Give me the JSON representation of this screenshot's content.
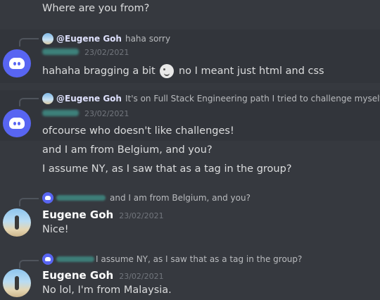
{
  "messages": [
    {
      "text": "Where are you from?"
    },
    {
      "reply": {
        "mention": "@Eugene Goh",
        "text": "haha sorry"
      },
      "timestamp": "23/02/2021",
      "lines": [
        "hahaha bragging a bit",
        "no I meant just html and css"
      ]
    },
    {
      "reply": {
        "mention": "@Eugene Goh",
        "text": "It's on Full Stack Engineering path I tried to challenge myself."
      },
      "timestamp": "23/02/2021",
      "lines": [
        "ofcourse who doesn't like challenges!",
        "and I am from Belgium, and you?",
        "I assume NY, as I saw that as a tag in the group?"
      ]
    },
    {
      "reply": {
        "text": "and I am from Belgium, and you?"
      },
      "author": "Eugene Goh",
      "timestamp": "23/02/2021",
      "lines": [
        "Nice!"
      ]
    },
    {
      "reply": {
        "text": "I assume NY, as I saw that as a tag in the group?"
      },
      "author": "Eugene Goh",
      "timestamp": "23/02/2021",
      "lines": [
        "No lol, I'm from Malaysia."
      ]
    }
  ]
}
